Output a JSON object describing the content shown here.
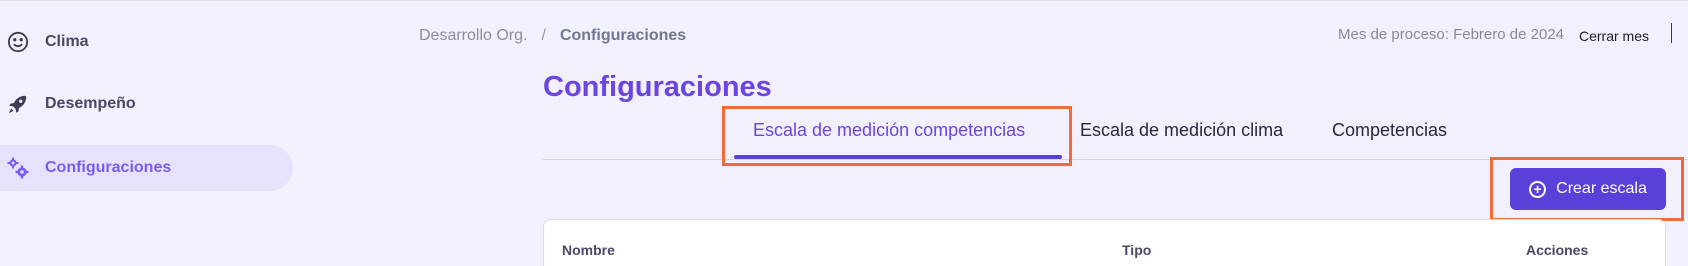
{
  "sidebar": {
    "items": [
      {
        "label": "Clima",
        "icon": "smile-icon",
        "active": false
      },
      {
        "label": "Desempeño",
        "icon": "rocket-icon",
        "active": false
      },
      {
        "label": "Configuraciones",
        "icon": "gears-icon",
        "active": true
      }
    ]
  },
  "breadcrumb": {
    "parent": "Desarrollo Org.",
    "separator": "/",
    "current": "Configuraciones"
  },
  "header": {
    "process_month": "Mes de proceso: Febrero de 2024",
    "close_month_label": "Cerrar mes"
  },
  "page": {
    "title": "Configuraciones"
  },
  "tabs": [
    {
      "label": "Escala de medición competencias",
      "active": true
    },
    {
      "label": "Escala de medición clima",
      "active": false
    },
    {
      "label": "Competencias",
      "active": false
    }
  ],
  "actions": {
    "create_label": "Crear escala"
  },
  "table": {
    "columns": [
      "Nombre",
      "Tipo",
      "Acciones"
    ]
  },
  "colors": {
    "accent": "#6a45e0",
    "button": "#5b3fd9",
    "highlight": "#f06a3a",
    "background": "#f2f0fc"
  }
}
